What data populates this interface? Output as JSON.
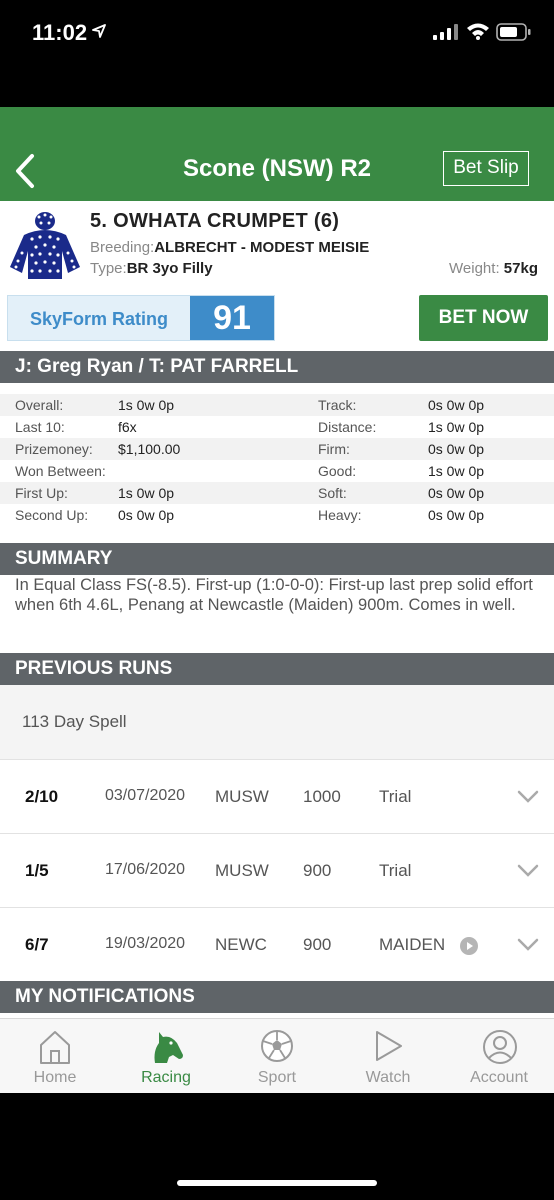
{
  "status": {
    "time": "11:02"
  },
  "header": {
    "title": "Scone (NSW) R2",
    "bet_slip": "Bet Slip"
  },
  "runner": {
    "name": "5. OWHATA CRUMPET (6)",
    "breeding_label": "Breeding:",
    "breeding": "ALBRECHT - MODEST MEISIE",
    "type_label": "Type:",
    "type": "BR 3yo Filly",
    "weight_label": "Weight:",
    "weight": "57kg"
  },
  "skyform": {
    "label": "SkyForm Rating",
    "value": "91"
  },
  "bet_now": "BET NOW",
  "jockey_trainer": "J: Greg Ryan / T: PAT FARRELL",
  "stats": [
    {
      "l1": "Overall:",
      "v1": "1s 0w 0p",
      "l2": "Track:",
      "v2": "0s 0w 0p"
    },
    {
      "l1": "Last 10:",
      "v1": "f6x",
      "l2": "Distance:",
      "v2": "1s 0w 0p"
    },
    {
      "l1": "Prizemoney:",
      "v1": "$1,100.00",
      "l2": "Firm:",
      "v2": "0s 0w 0p"
    },
    {
      "l1": "Won Between:",
      "v1": "",
      "l2": "Good:",
      "v2": "1s 0w 0p"
    },
    {
      "l1": "First Up:",
      "v1": "1s 0w 0p",
      "l2": "Soft:",
      "v2": "0s 0w 0p"
    },
    {
      "l1": "Second Up:",
      "v1": "0s 0w 0p",
      "l2": "Heavy:",
      "v2": "0s 0w 0p"
    }
  ],
  "summary": {
    "title": "SUMMARY",
    "text": "In Equal Class FS(-8.5). First-up (1:0-0-0): First-up last prep solid effort when 6th 4.6L, Penang at Newcastle (Maiden) 900m. Comes in well."
  },
  "previous_runs": {
    "title": "PREVIOUS RUNS",
    "spell": "113 Day Spell",
    "runs": [
      {
        "pos": "2/10",
        "date": "03/07/2020",
        "track": "MUSW",
        "dist": "1000",
        "class": "Trial"
      },
      {
        "pos": "1/5",
        "date": "17/06/2020",
        "track": "MUSW",
        "dist": "900",
        "class": "Trial"
      },
      {
        "pos": "6/7",
        "date": "19/03/2020",
        "track": "NEWC",
        "dist": "900",
        "class": "MAIDEN"
      }
    ]
  },
  "notifications": {
    "title": "MY NOTIFICATIONS"
  },
  "tabs": [
    {
      "label": "Home",
      "icon": "home-icon"
    },
    {
      "label": "Racing",
      "icon": "horse-head-icon",
      "active": true
    },
    {
      "label": "Sport",
      "icon": "soccer-ball-icon"
    },
    {
      "label": "Watch",
      "icon": "play-icon"
    },
    {
      "label": "Account",
      "icon": "account-icon"
    }
  ],
  "colors": {
    "brand_green": "#3a8a44",
    "skyform_blue": "#3e8cc9",
    "section_grey": "#5f6468"
  }
}
